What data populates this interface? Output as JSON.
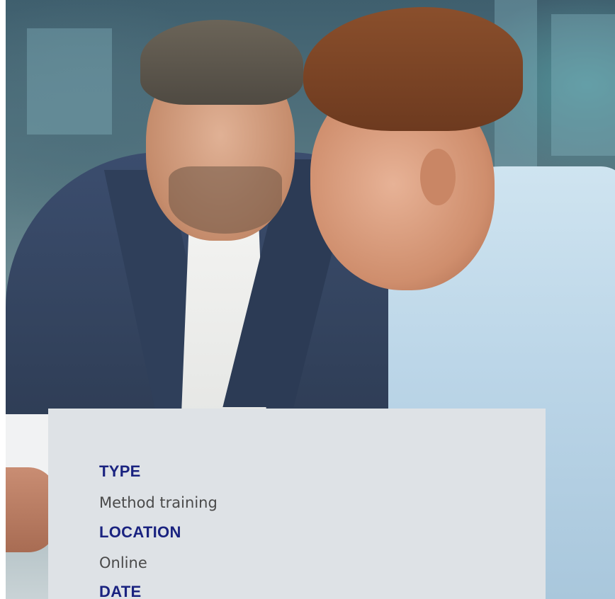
{
  "hero": {
    "image_description_icon": "photo-two-businessmen-looking-at-tablet"
  },
  "info_card": {
    "fields": [
      {
        "label": "TYPE",
        "value": "Method training"
      },
      {
        "label": "LOCATION",
        "value": "Online"
      },
      {
        "label": "DATE",
        "value": ""
      }
    ]
  },
  "colors": {
    "label": "#1a2380",
    "value": "#4a4a4a",
    "card_background": "#dee2e6"
  }
}
